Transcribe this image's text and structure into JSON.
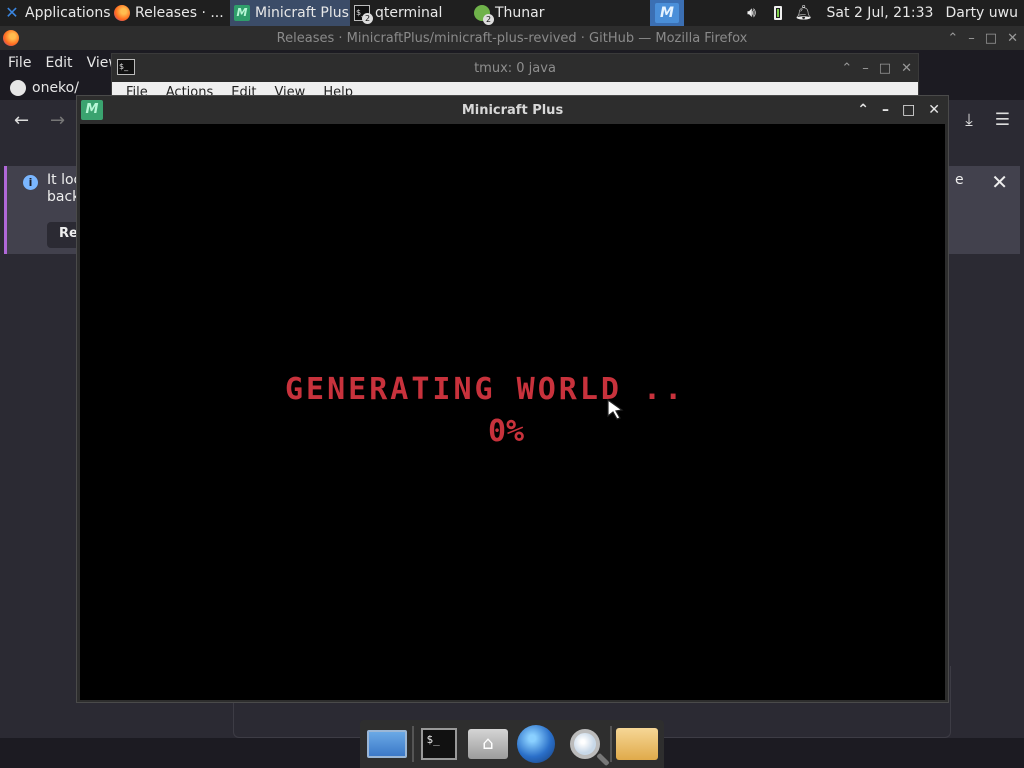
{
  "panel": {
    "applications_label": "Applications",
    "tasks": [
      {
        "label": "Releases · ..."
      },
      {
        "label": "Minicraft Plus"
      },
      {
        "label": "qterminal",
        "badge": "2"
      },
      {
        "label": "Thunar",
        "badge": "2"
      }
    ],
    "clock": "Sat  2 Jul, 21:33",
    "user": "Darty uwu"
  },
  "firefox": {
    "window_title": "Releases · MinicraftPlus/minicraft-plus-revived · GitHub — Mozilla Firefox",
    "menu": [
      "File",
      "Edit",
      "View"
    ],
    "tab_label": "oneko/",
    "notice_text": "It loc back",
    "notice_button": "Ret",
    "notice_tail": "e"
  },
  "tmux": {
    "title": "tmux: 0 java",
    "menu": [
      "File",
      "Actions",
      "Edit",
      "View",
      "Help"
    ]
  },
  "minicraft": {
    "title": "Minicraft Plus",
    "status_text": "Generating World ..",
    "progress_text": "0%"
  },
  "colors": {
    "game_text": "#c8323c",
    "panel_bg": "#1f1f1f",
    "active_task": "#3b4c68"
  }
}
